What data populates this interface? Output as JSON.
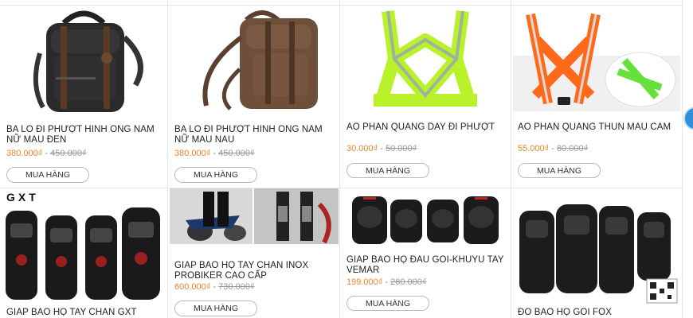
{
  "buy_label": "MUA HÀNG",
  "colors": {
    "price_new": "#e8852c",
    "price_old": "#999999",
    "accent_circle": "#2f8fd8"
  },
  "products": [
    {
      "title": "BA LO ĐI PHƯỢT HINH ONG NAM NỮ MAU ĐEN",
      "price_new": "380.000₫",
      "price_old": "450.000₫",
      "image": "black-backpack"
    },
    {
      "title": "BA LO ĐI PHƯỢT HINH ONG NAM NỮ MAU NAU",
      "price_new": "380.000₫",
      "price_old": "450.000₫",
      "image": "brown-backpack"
    },
    {
      "title": "AO PHAN QUANG DAY ĐI PHƯỢT",
      "price_new": "30.000₫",
      "price_old": "50.000₫",
      "image": "green-reflective-vest"
    },
    {
      "title": "AO PHAN QUANG THUN MAU CAM",
      "price_new": "55.000₫",
      "price_old": "80.000₫",
      "image": "orange-reflective-vest"
    },
    {
      "title": "GIAP BAO HỌ TAY CHAN GXT",
      "price_new": "",
      "price_old": "",
      "image": "gxt-knee-guards",
      "logo": "GXT"
    },
    {
      "title": "GIAP BAO HỌ TAY CHAN INOX PROBIKER CAO CẤP",
      "price_new": "600.000₫",
      "price_old": "730.000₫",
      "image": "probiker-guards-photos"
    },
    {
      "title": "GIAP BAO HỌ ĐAU GOI-KHUYU TAY VEMAR",
      "price_new": "199.000₫",
      "price_old": "280.000₫",
      "image": "vemar-pads"
    },
    {
      "title": "ĐO BAO HỌ GOI FOX",
      "price_new": "",
      "price_old": "",
      "image": "fox-knee-guards"
    }
  ]
}
